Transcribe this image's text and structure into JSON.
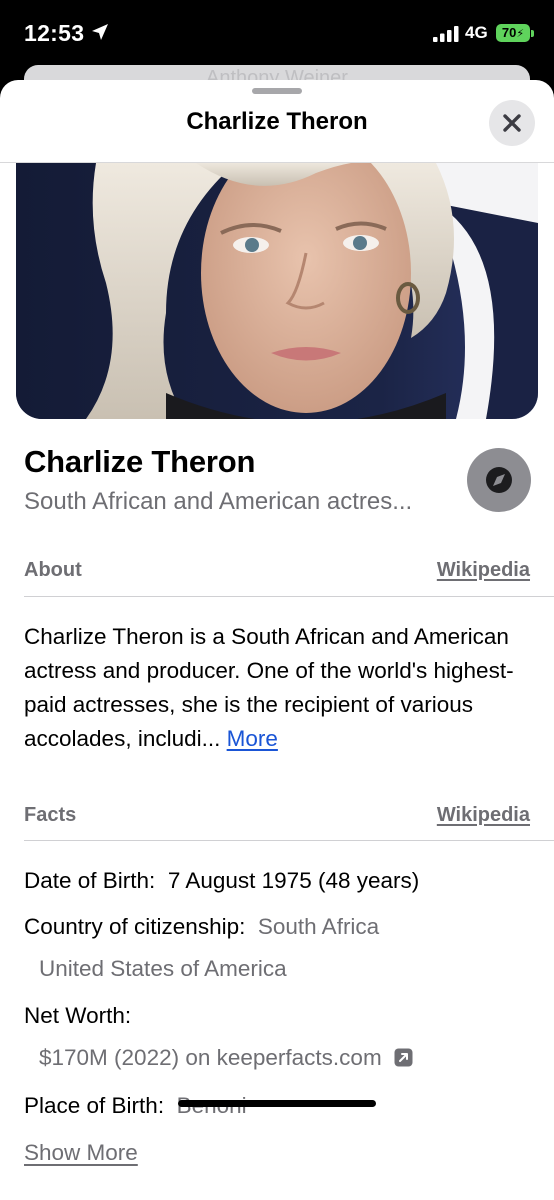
{
  "status_bar": {
    "time": "12:53",
    "network": "4G",
    "battery": "70"
  },
  "back_card": {
    "text": "Anthony Weiner"
  },
  "sheet": {
    "title": "Charlize Theron"
  },
  "profile": {
    "name": "Charlize Theron",
    "subtitle": "South African and American actres..."
  },
  "about": {
    "label": "About",
    "source": "Wikipedia",
    "text": "Charlize Theron is a South African and American actress and producer. One of the world's highest-paid actresses, she is the recipient of various accolades, includi...",
    "more": "More"
  },
  "facts": {
    "label": "Facts",
    "source": "Wikipedia",
    "dob_label": "Date of Birth:",
    "dob_value": "7 August 1975 (48 years)",
    "citizenship_label": "Country of citizenship:",
    "citizenship_1": "South Africa",
    "citizenship_2": "United States of America",
    "net_worth_label": "Net Worth:",
    "net_worth_value": "$170M (2022) on keeperfacts.com",
    "birthplace_label": "Place of Birth:",
    "birthplace_value": "Benoni",
    "show_more": "Show More"
  },
  "colors": {
    "link_blue": "#1a55d6",
    "secondary_gray": "#6e6e73",
    "battery_green": "#5fd35c"
  },
  "icons": [
    "location-arrow-icon",
    "signal-icon",
    "battery-icon",
    "close-icon",
    "compass-icon",
    "external-link-icon"
  ]
}
